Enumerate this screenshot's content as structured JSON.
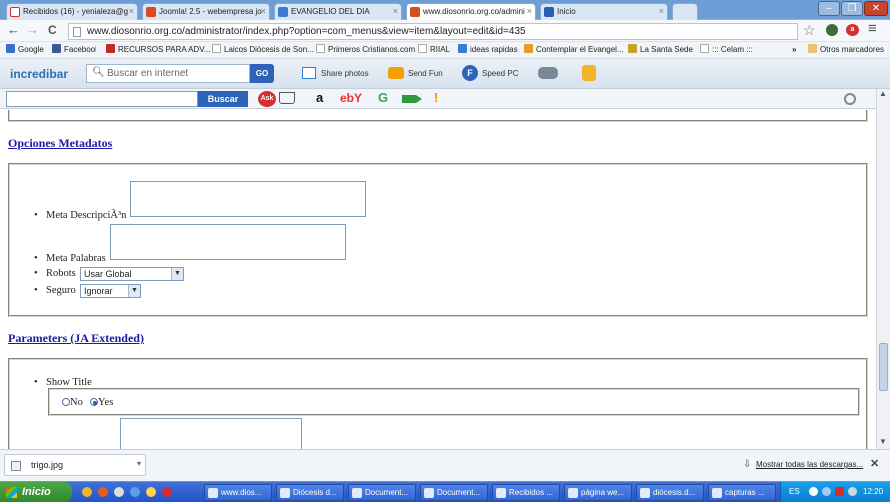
{
  "tabs": [
    {
      "label": "Recibidos (16) - yenialeza@g",
      "icon": "gmail-icon",
      "color": "#d93025",
      "active": false
    },
    {
      "label": "Joomla! 2.5 - webempresa jo",
      "icon": "joomla-icon",
      "color": "#d94c1f",
      "active": false
    },
    {
      "label": "EVANGELIO DEL DIA",
      "icon": "evangelio-icon",
      "color": "#3a7bd5",
      "active": false
    },
    {
      "label": "www.diosonrio.org.co/admini",
      "icon": "joomla-icon",
      "color": "#d94c1f",
      "active": true
    },
    {
      "label": "Inicio",
      "icon": "site-icon",
      "color": "#2a5db0",
      "active": false
    }
  ],
  "window": {
    "minimize": "–",
    "restore": "❐",
    "close": "✕"
  },
  "nav": {
    "back": "←",
    "forward": "→",
    "reload": "C",
    "url": "www.diosonrio.org.co/administrator/index.php?option=com_menus&view=item&layout=edit&id=435",
    "star": "☆",
    "menu": "≡"
  },
  "bookmarks": [
    {
      "label": "Google",
      "color": "#3b6fc4"
    },
    {
      "label": "Facebook",
      "color": "#3b5998"
    },
    {
      "label": "RECURSOS PARA ADV...",
      "color": "#c62828"
    },
    {
      "label": "Laicos Diócesis de Son...",
      "color": "#bbbbbb"
    },
    {
      "label": "Primeros Cristianos.com",
      "color": "#bbbbbb"
    },
    {
      "label": "RIIAL",
      "color": "#bbbbbb"
    },
    {
      "label": "ideas rapidas",
      "color": "#3a7bd5"
    },
    {
      "label": "Contemplar el Evangel...",
      "color": "#e6a020"
    },
    {
      "label": "La Santa Sede",
      "color": "#c9a227"
    },
    {
      "label": "::: Celam :::",
      "color": "#bbbbbb"
    }
  ],
  "bookmarks_more": "»",
  "bookmarks_other": "Otros marcadores",
  "incredibar": {
    "brand": "incredibar",
    "search_placeholder": "Buscar en internet",
    "go": "GO",
    "share": "Share photos",
    "send": "Send Fun",
    "speed": "Speed PC"
  },
  "searchbar": {
    "button": "Buscar",
    "ask": "Ask",
    "amazon": "a",
    "ebay": "ebY",
    "google": "G",
    "excl": "!"
  },
  "content": {
    "metadata_title": "Opciones Metadatos",
    "meta_description": "Meta DescripciÃ³n",
    "meta_keywords": "Meta Palabras",
    "robots_label": "Robots",
    "robots_value": "Usar Global",
    "secure_label": "Seguro",
    "secure_value": "Ignorar",
    "params_title": "Parameters (JA Extended)",
    "show_title": "Show Title",
    "radio_no": "No",
    "radio_yes": "Yes",
    "show_title_selected": "Yes"
  },
  "downloads": {
    "file": "trigo.jpg",
    "show_all": "Mostrar todas las descargas...",
    "close": "✕"
  },
  "taskbar": {
    "start": "Inicio",
    "tasks": [
      "www.dios...",
      "Diócesis d...",
      "Document...",
      "Document...",
      "Recibidos ...",
      "página we...",
      "diócesis.d...",
      "capturas ..."
    ],
    "lang": "ES",
    "clock": "12:20"
  },
  "colors": {
    "link": "#1a1aa6",
    "tabstrip": "#6c9dd4",
    "taskbar": "#2455c8"
  }
}
